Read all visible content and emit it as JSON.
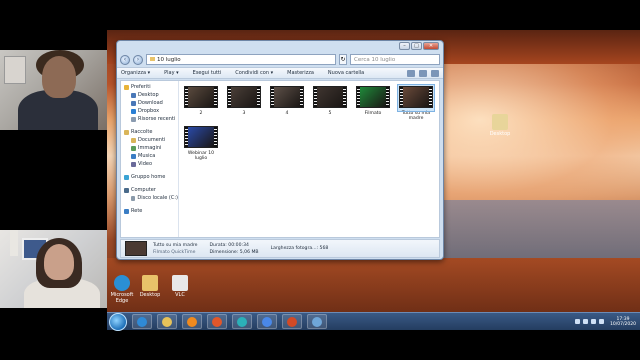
{
  "explorer": {
    "breadcrumb": "10 luglio",
    "search_placeholder": "Cerca 10 luglio",
    "toolbar": [
      "Organizza ▾",
      "Play ▾",
      "Esegui tutti",
      "Condividi con ▾",
      "Masterizza",
      "Nuova cartella"
    ],
    "nav": [
      {
        "label": "Preferiti",
        "level": 0,
        "icon": "star-icon",
        "color": "#e8b339"
      },
      {
        "label": "Desktop",
        "level": 1,
        "icon": "desktop-icon",
        "color": "#4a78b8"
      },
      {
        "label": "Download",
        "level": 1,
        "icon": "download-icon",
        "color": "#4a78b8"
      },
      {
        "label": "Dropbox",
        "level": 1,
        "icon": "dropbox-icon",
        "color": "#2a7fd4"
      },
      {
        "label": "Risorse recenti",
        "level": 1,
        "icon": "recent-icon",
        "color": "#8a9bb0"
      },
      {
        "label": "Raccolte",
        "level": 0,
        "icon": "library-icon",
        "color": "#d9b55a"
      },
      {
        "label": "Documenti",
        "level": 1,
        "icon": "documents-icon",
        "color": "#d9b55a"
      },
      {
        "label": "Immagini",
        "level": 1,
        "icon": "pictures-icon",
        "color": "#5a9c5a"
      },
      {
        "label": "Musica",
        "level": 1,
        "icon": "music-icon",
        "color": "#3a7dc4"
      },
      {
        "label": "Video",
        "level": 1,
        "icon": "video-icon",
        "color": "#6a6a9a"
      },
      {
        "label": "Gruppo home",
        "level": 0,
        "icon": "homegroup-icon",
        "color": "#3aa3d4"
      },
      {
        "label": "Computer",
        "level": 0,
        "icon": "computer-icon",
        "color": "#4a6a8a"
      },
      {
        "label": "Disco locale (C:)",
        "level": 1,
        "icon": "drive-icon",
        "color": "#8a9aaa"
      },
      {
        "label": "Rete",
        "level": 0,
        "icon": "network-icon",
        "color": "#3a7dc4"
      }
    ],
    "files": [
      {
        "name": "2",
        "scene": "#5a4a3e"
      },
      {
        "name": "3",
        "scene": "#4a3f38"
      },
      {
        "name": "4",
        "scene": "#5d5048"
      },
      {
        "name": "5",
        "scene": "#3f3530"
      },
      {
        "name": "Filmato",
        "scene": "#1f8a3a"
      },
      {
        "name": "Tutto su mia madre",
        "scene": "#6a4a3a",
        "selected": true
      },
      {
        "name": "Webinar 10 luglio",
        "scene": "#2a4aa8"
      }
    ],
    "status": {
      "name": "Tutto su mia madre",
      "type": "Filmato QuickTime",
      "duration": "Durata: 00:00:34",
      "size": "Dimensione: 5,06 MB",
      "width": "Larghezza fotogra...: 568"
    }
  },
  "desktop_icons": [
    {
      "label": "Microsoft Edge",
      "color": "#2a8fd4"
    },
    {
      "label": "Desktop",
      "color": "#e8c36a"
    },
    {
      "label": "VLC",
      "color": "#e8e8e8"
    },
    {
      "label": "Desktop",
      "color": "#e8d59a"
    }
  ],
  "taskbar": {
    "apps": [
      {
        "name": "ie-icon",
        "color": "#2f8ad6"
      },
      {
        "name": "explorer-icon",
        "color": "#e6c25a"
      },
      {
        "name": "media-player-icon",
        "color": "#f08a1e"
      },
      {
        "name": "firefox-icon",
        "color": "#e2572b"
      },
      {
        "name": "edge-icon",
        "color": "#2bb0b8"
      },
      {
        "name": "google-icon",
        "color": "#4a88e8"
      },
      {
        "name": "powerpoint-icon",
        "color": "#d24a26"
      },
      {
        "name": "settings-icon",
        "color": "#6fa6d8"
      }
    ],
    "time": "17:39",
    "date": "10/07/2020"
  }
}
